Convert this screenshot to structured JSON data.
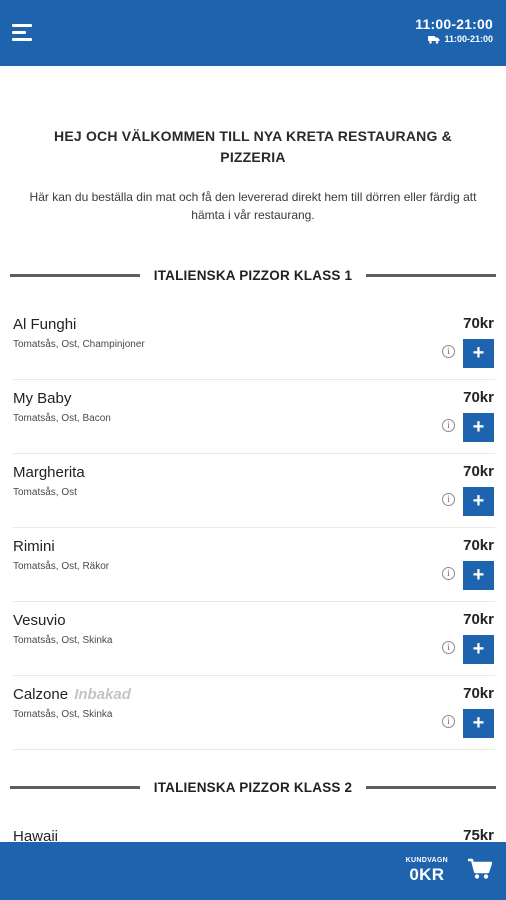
{
  "header": {
    "hours": "11:00-21:00",
    "delivery_hours": "11:00-21:00",
    "icons": {
      "menu": "hamburger-menu-icon",
      "delivery": "truck-icon"
    }
  },
  "welcome": {
    "title": "HEJ OCH VÄLKOMMEN TILL NYA KRETA RESTAURANG & PIZZERIA",
    "text": "Här kan du beställa din mat och få den levererad direkt hem till dörren eller färdig att hämta i vår restaurang."
  },
  "sections": [
    {
      "title": "ITALIENSKA PIZZOR KLASS 1",
      "items": [
        {
          "name": "Al Funghi",
          "note": "",
          "description": "Tomatsås, Ost, Champinjoner",
          "price": "70kr"
        },
        {
          "name": "My Baby",
          "note": "",
          "description": "Tomatsås, Ost, Bacon",
          "price": "70kr"
        },
        {
          "name": "Margherita",
          "note": "",
          "description": "Tomatsås, Ost",
          "price": "70kr"
        },
        {
          "name": "Rimini",
          "note": "",
          "description": "Tomatsås, Ost, Räkor",
          "price": "70kr"
        },
        {
          "name": "Vesuvio",
          "note": "",
          "description": "Tomatsås, Ost, Skinka",
          "price": "70kr"
        },
        {
          "name": "Calzone",
          "note": "Inbakad",
          "description": "Tomatsås, Ost, Skinka",
          "price": "70kr"
        }
      ]
    },
    {
      "title": "ITALIENSKA PIZZOR KLASS 2",
      "items": [
        {
          "name": "Hawaii",
          "note": "",
          "description": "",
          "price": "75kr"
        }
      ]
    }
  ],
  "item_controls": {
    "info_symbol": "i",
    "add_symbol": "+"
  },
  "cart": {
    "label": "KUNDVAGN",
    "total": "0KR",
    "icon": "shopping-cart-icon"
  },
  "colors": {
    "primary": "#1e63ad",
    "divider": "#5a5f66",
    "note": "#c4c4c4"
  }
}
